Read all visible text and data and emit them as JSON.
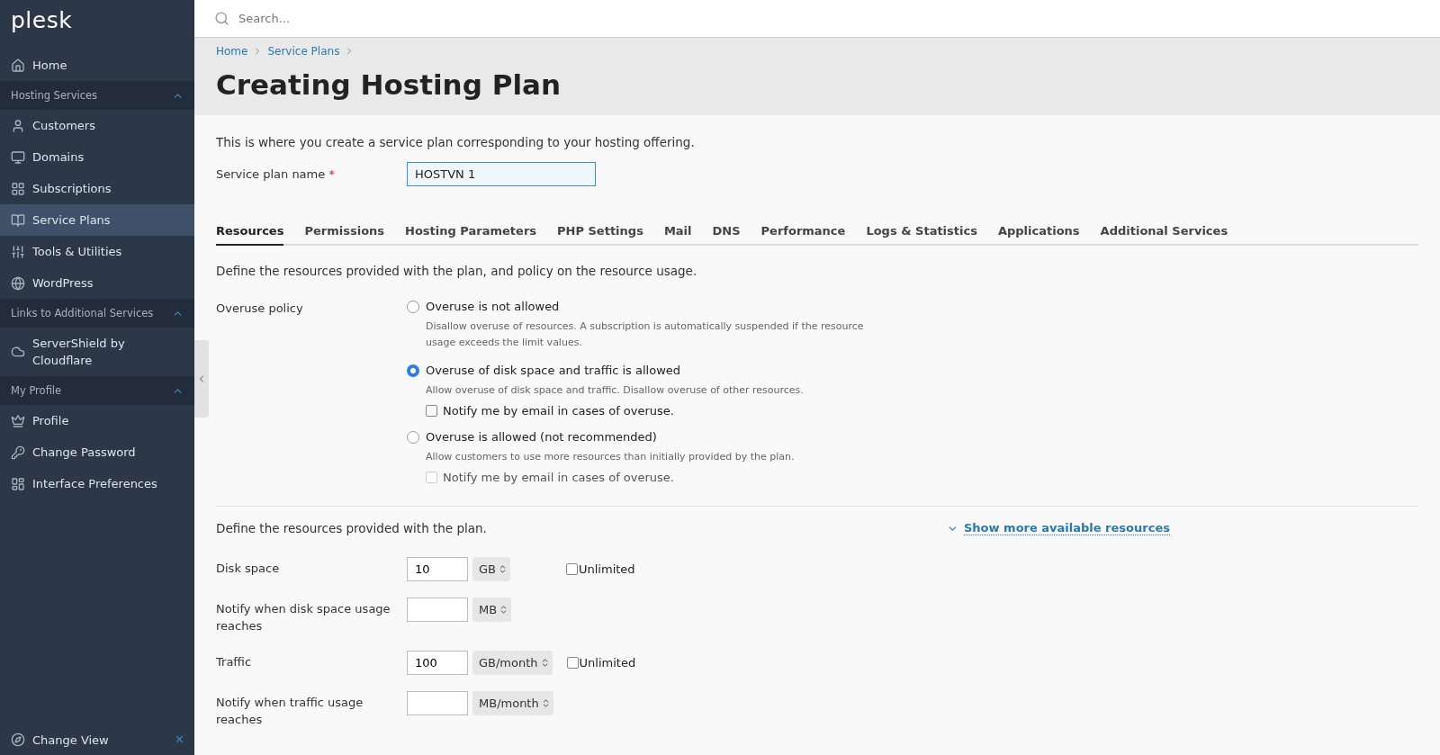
{
  "sidebar": {
    "logo": "plesk",
    "items": [
      {
        "kind": "link",
        "label": "Home",
        "selected": false
      },
      {
        "kind": "section",
        "label": "Hosting Services",
        "expanded": true
      },
      {
        "kind": "link",
        "label": "Customers",
        "selected": false
      },
      {
        "kind": "link",
        "label": "Domains",
        "selected": false
      },
      {
        "kind": "link",
        "label": "Subscriptions",
        "selected": false
      },
      {
        "kind": "link",
        "label": "Service Plans",
        "selected": true
      },
      {
        "kind": "link",
        "label": "Tools & Utilities",
        "selected": false
      },
      {
        "kind": "link",
        "label": "WordPress",
        "selected": false
      },
      {
        "kind": "section",
        "label": "Links to Additional Services",
        "expanded": true
      },
      {
        "kind": "link",
        "label": "ServerShield by Cloudflare",
        "selected": false
      },
      {
        "kind": "section",
        "label": "My Profile",
        "expanded": true
      },
      {
        "kind": "link",
        "label": "Profile",
        "selected": false
      },
      {
        "kind": "link",
        "label": "Change Password",
        "selected": false
      },
      {
        "kind": "link",
        "label": "Interface Preferences",
        "selected": false
      }
    ],
    "footer": {
      "label": "Change View",
      "close": "×"
    }
  },
  "search": {
    "placeholder": "Search..."
  },
  "breadcrumbs": [
    "Home",
    "Service Plans"
  ],
  "page_title": "Creating Hosting Plan",
  "intro": "This is where you create a service plan corresponding to your hosting offering.",
  "plan_name": {
    "label": "Service plan name",
    "required_mark": "*",
    "value": "HOSTVN 1"
  },
  "tabs": [
    {
      "label": "Resources",
      "selected": true
    },
    {
      "label": "Permissions",
      "selected": false
    },
    {
      "label": "Hosting Parameters",
      "selected": false
    },
    {
      "label": "PHP Settings",
      "selected": false
    },
    {
      "label": "Mail",
      "selected": false
    },
    {
      "label": "DNS",
      "selected": false
    },
    {
      "label": "Performance",
      "selected": false
    },
    {
      "label": "Logs & Statistics",
      "selected": false
    },
    {
      "label": "Applications",
      "selected": false
    },
    {
      "label": "Additional Services",
      "selected": false
    }
  ],
  "policy_intro": "Define the resources provided with the plan, and policy on the resource usage.",
  "overuse_policy": {
    "label": "Overuse policy",
    "options": [
      {
        "label": "Overuse is not allowed",
        "selected": false,
        "description": "Disallow overuse of resources. A subscription is automatically suspended if the resource usage exceeds the limit values."
      },
      {
        "label": "Overuse of disk space and traffic is allowed",
        "selected": true,
        "description": "Allow overuse of disk space and traffic. Disallow overuse of other resources.",
        "notify": {
          "label": "Notify me by email in cases of overuse.",
          "checked": false,
          "disabled": false
        }
      },
      {
        "label": "Overuse is allowed (not recommended)",
        "selected": false,
        "description": "Allow customers to use more resources than initially provided by the plan.",
        "notify": {
          "label": "Notify me by email in cases of overuse.",
          "checked": false,
          "disabled": true
        }
      }
    ]
  },
  "resources_intro": "Define the resources provided with the plan.",
  "show_more": "Show more available resources",
  "resources": [
    {
      "label": "Disk space",
      "value": "10",
      "unit": "GB",
      "unlimited": {
        "label": "Unlimited",
        "checked": false
      }
    },
    {
      "label": "Notify when disk space usage reaches",
      "unit": "MB"
    },
    {
      "label": "Traffic",
      "value": "100",
      "unit": "GB/month",
      "unlimited": {
        "label": "Unlimited",
        "checked": false
      }
    },
    {
      "label": "Notify when traffic usage reaches",
      "unit": "MB/month"
    }
  ]
}
